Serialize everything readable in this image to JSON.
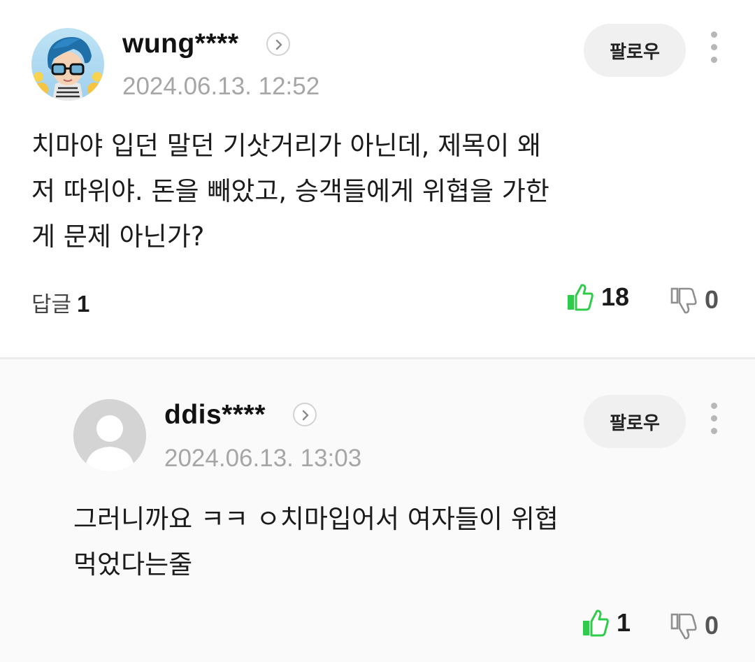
{
  "comments": [
    {
      "username": "wung****",
      "timestamp": "2024.06.13. 12:52",
      "follow_label": "팔로우",
      "body_lines": [
        "치마야 입던 말던 기삿거리가 아닌데, 제목이 왜",
        "저 따위야. 돈을 빼았고, 승객들에게 위협을 가한",
        "게 문제 아닌가?"
      ],
      "reply_label": "답글",
      "reply_count": "1",
      "likes": "18",
      "dislikes": "0",
      "avatar": "cartoon-avatar-icon"
    },
    {
      "username": "ddis****",
      "timestamp": "2024.06.13. 13:03",
      "follow_label": "팔로우",
      "body_lines": [
        "그러니까요 ㅋㅋ ㅇ치마입어서 여자들이 위협",
        "먹었다는줄"
      ],
      "likes": "1",
      "dislikes": "0",
      "avatar": "default-user-icon"
    }
  ],
  "colors": {
    "like_green": "#2ecc4a",
    "muted_text": "#a6a6a6",
    "button_bg": "#f0f0f0",
    "reply_bg": "#fafafa"
  }
}
